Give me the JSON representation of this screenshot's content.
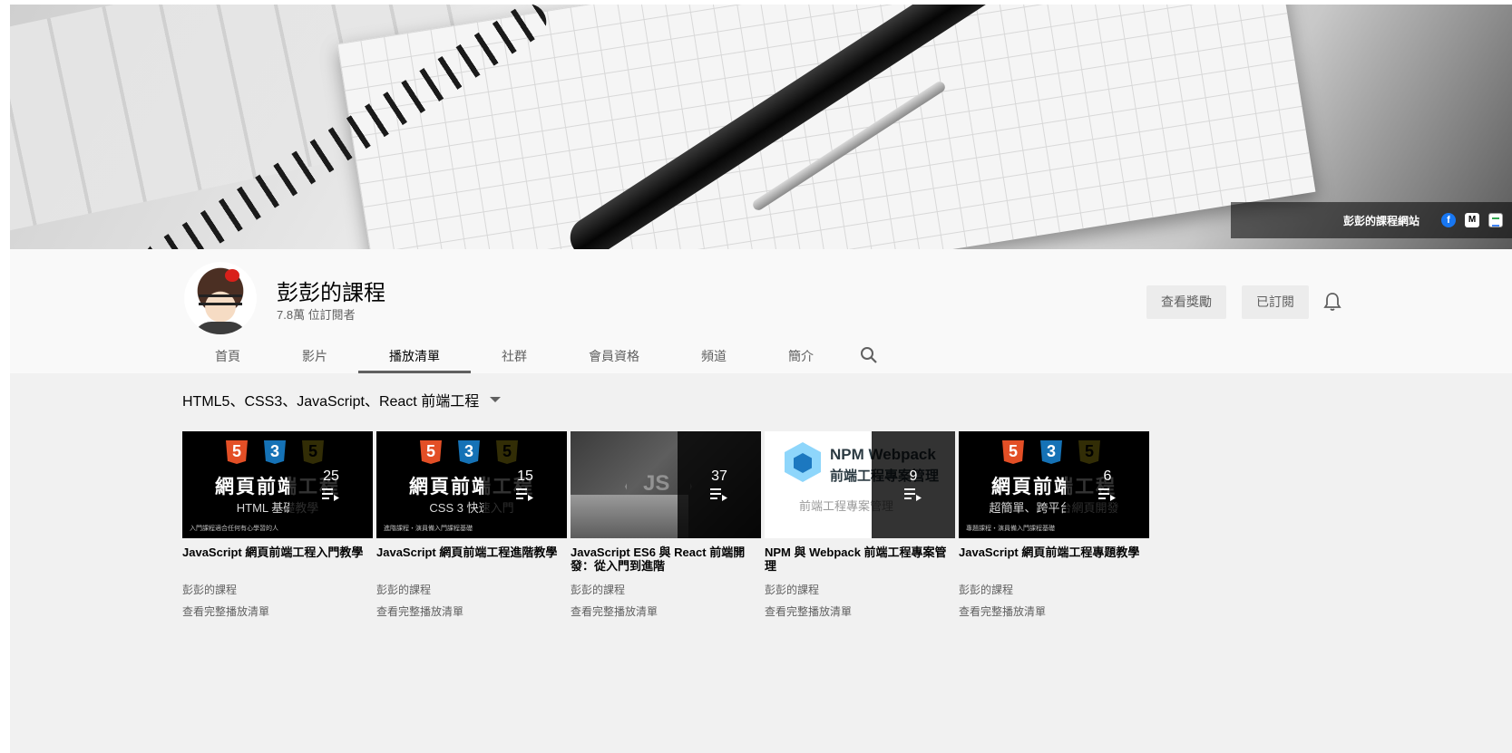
{
  "banner": {
    "link_text": "彭彭的課程網站",
    "social_icons": [
      "facebook-icon",
      "medium-icon",
      "google-sites-icon"
    ],
    "fb_glyph": "f",
    "md_glyph": "M"
  },
  "channel": {
    "name": "彭彭的課程",
    "subscribers": "7.8萬 位訂閱者",
    "join_label": "查看獎勵",
    "subscribed_label": "已訂閱"
  },
  "tabs": [
    {
      "label": "首頁",
      "active": false
    },
    {
      "label": "影片",
      "active": false
    },
    {
      "label": "播放清單",
      "active": true
    },
    {
      "label": "社群",
      "active": false
    },
    {
      "label": "會員資格",
      "active": false
    },
    {
      "label": "頻道",
      "active": false
    },
    {
      "label": "簡介",
      "active": false
    }
  ],
  "section": {
    "title": "HTML5、CSS3、JavaScript、React 前端工程"
  },
  "thumb_text": {
    "badge5": "5",
    "badge3": "3",
    "web_frontend": "網頁前端工程",
    "html_basic": "HTML 基礎教學",
    "css3_quick": "CSS 3 快速入門",
    "special_topic": "超簡單、跨平台網頁開發",
    "foot1": "入門課程適合任何有心學習的人",
    "foot2": "進階課程・演員備入門課程基礎",
    "foot5": "專題課程・演員備入門課程基礎",
    "js_mark": "JS",
    "npm_t1": "NPM  Webpack",
    "npm_t2": "前端工程專案管理",
    "npm_t3": "前端工程專案管理"
  },
  "playlists": [
    {
      "count": "25",
      "title": "JavaScript 網頁前端工程入門教學",
      "channel": "彭彭的課程",
      "link": "查看完整播放清單"
    },
    {
      "count": "15",
      "title": "JavaScript 網頁前端工程進階教學",
      "channel": "彭彭的課程",
      "link": "查看完整播放清單"
    },
    {
      "count": "37",
      "title": "JavaScript ES6 與 React 前端開發：從入門到進階",
      "channel": "彭彭的課程",
      "link": "查看完整播放清單"
    },
    {
      "count": "9",
      "title": "NPM 與 Webpack 前端工程專案管理",
      "channel": "彭彭的課程",
      "link": "查看完整播放清單"
    },
    {
      "count": "6",
      "title": "JavaScript 網頁前端工程專題教學",
      "channel": "彭彭的課程",
      "link": "查看完整播放清單"
    }
  ],
  "colors": {
    "page_bg": "#f1f1f1",
    "header_bg": "#f9f9f9",
    "button_bg": "#ececec",
    "secondary_text": "#606060"
  }
}
